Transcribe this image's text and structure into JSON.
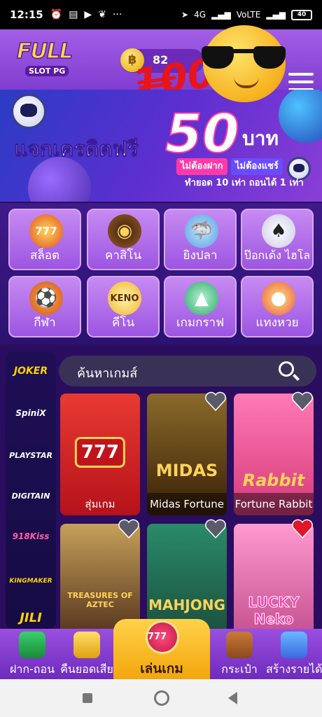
{
  "status_bar": {
    "time": "12:15",
    "network": "4G",
    "volte": "VoLTE",
    "battery": "40"
  },
  "header": {
    "logo_line1": "FULL",
    "logo_line2": "SLOT PG",
    "balance": "82",
    "emoji_overlay": "100"
  },
  "banner": {
    "headline": "แจกเครดิตฟรี",
    "amount": "50",
    "unit": "บาท",
    "tag1": "ไม่ต้องฝาก",
    "tag2": "ไม่ต้องแชร์",
    "subline": "ทำยอด 10 เท่า ถอนได้ 1 เท่า"
  },
  "categories": [
    {
      "label": "สล็อต",
      "icon": "slot-machine-icon",
      "glyph": "777"
    },
    {
      "label": "คาสิโน",
      "icon": "roulette-icon",
      "glyph": "◉"
    },
    {
      "label": "ยิงปลา",
      "icon": "shark-icon",
      "glyph": "🦈"
    },
    {
      "label": "ป๊อกเด้ง ไฮโล",
      "icon": "playing-cards-icon",
      "glyph": "♠"
    },
    {
      "label": "กีฬา",
      "icon": "sports-ball-icon",
      "glyph": "⚽"
    },
    {
      "label": "คีโน",
      "icon": "keno-icon",
      "glyph": "KENO"
    },
    {
      "label": "เกมกราฟ",
      "icon": "graph-icon",
      "glyph": "▲"
    },
    {
      "label": "แทงหวย",
      "icon": "lottery-balls-icon",
      "glyph": "●"
    }
  ],
  "providers": [
    "JOKER",
    "SpiniX",
    "PLAYSTAR",
    "DIGITAIN",
    "918Kiss",
    "KINGMAKER",
    "JILI"
  ],
  "search": {
    "placeholder": "ค้นหาเกมส์"
  },
  "games": [
    {
      "title": "สุ่มเกม",
      "art": "777"
    },
    {
      "title": "Midas Fortune",
      "art": "MIDAS"
    },
    {
      "title": "Fortune Rabbit",
      "art": "Rabbit"
    },
    {
      "title": "Treasures of Aztec",
      "art": "TREASURES OF AZTEC"
    },
    {
      "title": "Mahjong Ways",
      "art": "MAHJONG"
    },
    {
      "title": "Lucky Neko",
      "art": "LUCKY Neko"
    }
  ],
  "bottom_nav": {
    "deposit": "ฝาก-ถอน",
    "cashback": "คืนยอดเสีย",
    "play": "เล่นเกม",
    "wallet": "กระเป๋า",
    "affiliate": "สร้างรายได้"
  },
  "colors": {
    "header_purple": "#9b52e3",
    "nav_gold": "#f6b51c",
    "page_bg": "#2a0d5e"
  }
}
